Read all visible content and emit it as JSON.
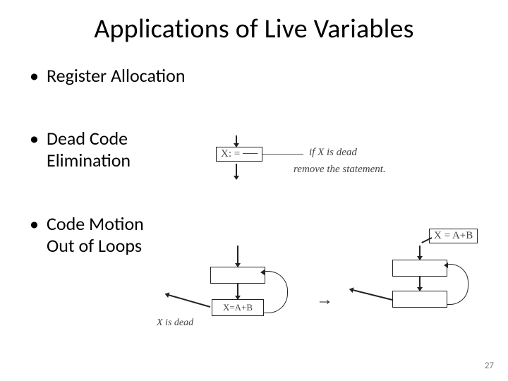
{
  "title": "Applications of Live Variables",
  "bullets": {
    "b1": "Register Allocation",
    "b2_line1": "Dead Code",
    "b2_line2": "Elimination",
    "b3_line1": "Code Motion",
    "b3_line2": "Out of Loops"
  },
  "annotations": {
    "dead": {
      "stmt": "X: = ──",
      "note1": "if X is dead",
      "note2": "remove the statement."
    },
    "motion": {
      "inner_stmt": "X=A+B",
      "dead_label": "X is dead",
      "arrow": "→",
      "hoisted_stmt": "X = A+B"
    }
  },
  "page_number": "27"
}
